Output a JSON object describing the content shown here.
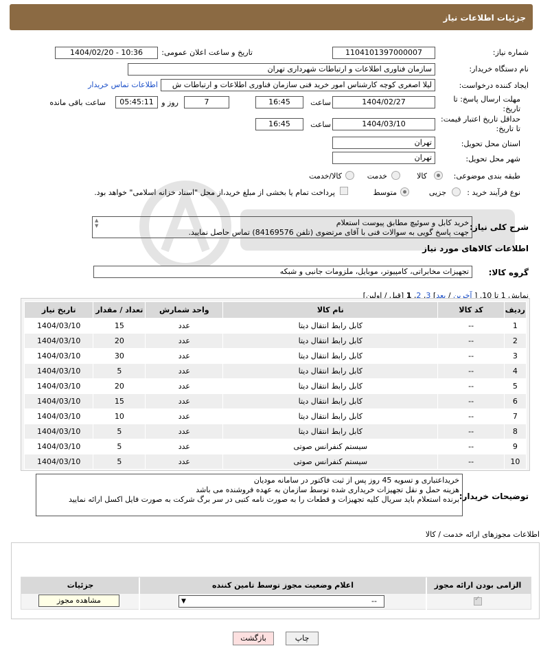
{
  "header": {
    "title": "جزئیات اطلاعات نیاز"
  },
  "fields": {
    "need_number_label": "شماره نیاز:",
    "need_number": "1104101397000007",
    "announce_label": "تاریخ و ساعت اعلان عمومی:",
    "announce_value": "1404/02/20 - 10:36",
    "buyer_org_label": "نام دستگاه خریدار:",
    "buyer_org": "سازمان فناوری اطلاعات و ارتباطات شهرداری تهران",
    "creator_label": "ایجاد کننده درخواست:",
    "creator": "لیلا اصغری کوچه کارشناس امور خرید فنی سازمان فناوری اطلاعات و ارتباطات ش",
    "buyer_contact_link": "اطلاعات تماس خریدار",
    "reply_deadline_label_1": "مهلت ارسال پاسخ: تا",
    "reply_deadline_label_2": "تاریخ:",
    "reply_date": "1404/02/27",
    "time_label": "ساعت",
    "reply_time": "16:45",
    "days_value": "7",
    "days_label": "روز و",
    "remaining_time": "05:45:11",
    "remaining_label": "ساعت باقی مانده",
    "price_deadline_label_1": "حداقل تاریخ اعتبار قیمت:",
    "price_deadline_label_2": "تا تاریخ:",
    "price_date": "1404/03/10",
    "price_time": "16:45",
    "province_label": "استان محل تحویل:",
    "province": "تهران",
    "city_label": "شهر محل تحویل:",
    "city": "تهران",
    "category_label": "طبقه بندی موضوعی:",
    "category_options": [
      "کالا",
      "خدمت",
      "کالا/خدمت"
    ],
    "purchase_type_label": "نوع فرآیند خرید :",
    "purchase_options": [
      "جزیی",
      "متوسط"
    ],
    "payment_note": "پرداخت تمام یا بخشی از مبلغ خرید،از محل \"اسناد خزانه اسلامی\" خواهد بود.",
    "description_label": "شرح کلی نیاز:",
    "description_line1": "خرید کابل و سوئیچ مطابق پیوست استعلام",
    "description_line2": "جهت پاسخ گویی به سوالات فنی با آقای مرتضوی (تلفن 84169576) تماس حاصل نمایید.",
    "goods_info_title": "اطلاعات کالاهای مورد نیاز",
    "goods_group_label": "گروه کالا:",
    "goods_group": "تجهیزات مخابراتی، کامپیوتر، موبایل، ملزومات جانبی و شبکه"
  },
  "pagination": {
    "show_text": "نمایش 1 تا 10.",
    "open": "[",
    "last": "آخرین",
    "sep1": "/",
    "next": "بعد",
    "close1": "]",
    "p3": "3",
    "c1": ",",
    "p2": "2",
    "c2": ",",
    "p1": "1",
    "rest": "[قبل / اولین]"
  },
  "table": {
    "headers": [
      "ردیف",
      "کد کالا",
      "نام کالا",
      "واحد شمارش",
      "تعداد / مقدار",
      "تاریخ نیاز"
    ],
    "rows": [
      [
        "1",
        "--",
        "کابل رابط انتقال دیتا",
        "عدد",
        "15",
        "1404/03/10"
      ],
      [
        "2",
        "--",
        "کابل رابط انتقال دیتا",
        "عدد",
        "20",
        "1404/03/10"
      ],
      [
        "3",
        "--",
        "کابل رابط انتقال دیتا",
        "عدد",
        "30",
        "1404/03/10"
      ],
      [
        "4",
        "--",
        "کابل رابط انتقال دیتا",
        "عدد",
        "5",
        "1404/03/10"
      ],
      [
        "5",
        "--",
        "کابل رابط انتقال دیتا",
        "عدد",
        "20",
        "1404/03/10"
      ],
      [
        "6",
        "--",
        "کابل رابط انتقال دیتا",
        "عدد",
        "15",
        "1404/03/10"
      ],
      [
        "7",
        "--",
        "کابل رابط انتقال دیتا",
        "عدد",
        "10",
        "1404/03/10"
      ],
      [
        "8",
        "--",
        "کابل رابط انتقال دیتا",
        "عدد",
        "5",
        "1404/03/10"
      ],
      [
        "9",
        "--",
        "سیستم کنفرانس صوتی",
        "عدد",
        "5",
        "1404/03/10"
      ],
      [
        "10",
        "--",
        "سیستم کنفرانس صوتی",
        "عدد",
        "5",
        "1404/03/10"
      ]
    ]
  },
  "buyer_notes": {
    "label": "توضیحات خریدار:",
    "line1": "خریداعتباری و تسویه 45 روز پس از ثبت فاکتور در سامانه مودیان",
    "line2": "هزینه حمل و نقل تجهیزات خریداری شده توسط سازمان به عهده فروشنده می باشد",
    "line3": "برنده استعلام باید سریال کلیه تجهیزات و قطعات را به صورت نامه کتبی در سر برگ شرکت به صورت فایل اکسل ارائه نمایید"
  },
  "permits": {
    "title": "اطلاعات مجوزهای ارائه خدمت / کالا",
    "headers": [
      "الزامی بودن ارائه مجوز",
      "اعلام وضعیت مجوز توسط تامین کننده",
      "جزئیات"
    ],
    "select_value": "--",
    "view_button": "مشاهده مجوز"
  },
  "buttons": {
    "print": "چاپ",
    "back": "بازگشت"
  },
  "colors": {
    "header_bg": "#8b6a43",
    "link": "#1a4ec8",
    "back_btn_bg": "#fde0e0"
  }
}
